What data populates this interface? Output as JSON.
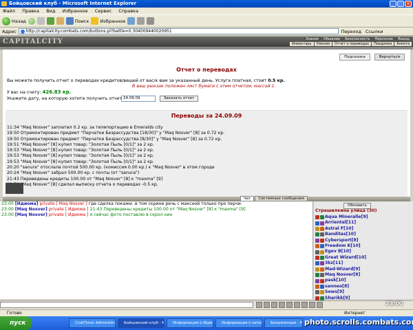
{
  "window": {
    "title": "Бойцовский клуб - Microsoft Internet Explorer"
  },
  "menu": [
    "Файл",
    "Правка",
    "Вид",
    "Избранное",
    "Сервис",
    "Справка"
  ],
  "toolbar": {
    "back": "Назад",
    "search": "Поиск",
    "favorites": "Избранное"
  },
  "address": {
    "label": "Адрес",
    "url": "http://capitalcity.combats.com/buttons.pl?battle=0.304009440020951",
    "go": "Переход",
    "links": "Ссылки"
  },
  "game": {
    "logo": "CAPITALCITY",
    "nav1": [
      "Знания",
      "Общение",
      "Безопасность",
      "Персонаж",
      "Выход"
    ],
    "nav2": [
      "Инвентарь",
      "Умения",
      "Отчет о переводах",
      "Поединки",
      "Анкета"
    ]
  },
  "page": {
    "buttons": [
      "Подсказка",
      "Вернуться"
    ],
    "title": "Отчет о переводах",
    "intro_pre": "Вы можете получить отчет о переводах кредитов/вещей от вас/к вам за указанный день. Услуга платная, стоит",
    "price": "0.5 кр.",
    "notice": "В ваш рюкзак положен лист бумаги с этим отчетом, массой 1.",
    "balance_label": "У вас на счету:",
    "balance": "426.83 кр.",
    "date_label": "Укажите дату, на которую хотите получить отчет:",
    "date_value": "24.09.09",
    "submit": "Заказать отчет",
    "transfers_title": "Переводы за 24.09.09",
    "log": [
      "11:34 \"Maq Nosver\" заплатил 0.2 кр. за телепортацию в Emeralds city",
      "19:50 Отремонтирован предмет \"Перчатки Безрассудства [18/30]\" у \"Maq Nosver\" [8] за 0.72 кр.",
      "19:50 Отремонтирован предмет \"Перчатки Безрассудства [8/30]\" у \"Maq Nosver\" [8] за 0.72 кр.",
      "19:51 \"Maq Nosver\" [8] купил товар: \"Золотая Пыль [0/1]\" за 2 кр.",
      "19:53 \"Maq Nosver\" [8] купил товар: \"Золотая Пыль [0/1]\" за 2 кр.",
      "19:53 \"Maq Nosver\" [8] купил товар: \"Золотая Пыль [0/1]\" за 2 кр.",
      "19:53 \"Maq Nosver\" [8] купил товар: \"Золотая Пыль [0/1]\" за 2 кр.",
      "20:20 \"sanura\" отослала почтой 500.00 кр. (комиссия 0.00 кр.) к \"Maq Nosver\" в этом городе",
      "20:24 \"Maq Nosver\" забрал 500.00 кр. с почты (от \"sanura\")",
      "21:43 Переведены кредиты 100.00 от \"Maq Nosver\" [8] к \"maxma\" [9]",
      "22:59 \"Maq Nosver\" [8] сделал выписку отчета о переводах -0.5 кр."
    ]
  },
  "chat": {
    "tabs": [
      "Чат",
      "Системные сообщения"
    ],
    "lines": [
      {
        "time": "23:00",
        "a": "[Идиома]",
        "kind": "private",
        "b": "[ Maq Nosver ]",
        "text": "где сделка покажи. в том скрине речь с максной только про перчи."
      },
      {
        "time": "23:00",
        "a": "[Maq Nosver]",
        "kind": "private",
        "b": "[ Идиома ]",
        "text": "21:43 Переведены кредиты 100.00 от \"Maq Nosver\" [8] к \"maxma\" [9]"
      },
      {
        "time": "23:00",
        "a": "[Maq Nosver]",
        "kind": "private",
        "b": "[ Идиома ]",
        "text": "я сейчас фото поставлю в скрол нин"
      }
    ]
  },
  "sidebar": {
    "refresh": "Обновить",
    "location": "Страшилкина улица (30)",
    "users": [
      "Aqua Mineralle[9]",
      "Arriental[11]",
      "Astral F[10]",
      "Banditas[10]",
      "Cybersport[8]",
      "Freedom K[10]",
      "Egev B[10]",
      "Great Wizard[10]",
      "3kz[11]",
      "Mad-Wizard[9]",
      "Maq Nosver[8]",
      "pask[10]",
      "sanneo[8]",
      "Sews[9]",
      "Sharikk[9]"
    ],
    "user_colors": [
      "#c03020",
      "#3060c0",
      "#c09020",
      "#208040",
      "#8040a0",
      "#d06010",
      "#606060"
    ]
  },
  "clock": "23:00",
  "status": {
    "left": "Готово",
    "zone": "Интернет"
  },
  "taskbar": {
    "start": "пуск",
    "tasks": [
      "ClubTimer Administrat...",
      "Бойцовский клуб - M...",
      "Информация о Идио...",
      "Информация о sahsk...",
      "Безымянный - Paint"
    ]
  },
  "watermark": "photo.scrolls.combats.com"
}
